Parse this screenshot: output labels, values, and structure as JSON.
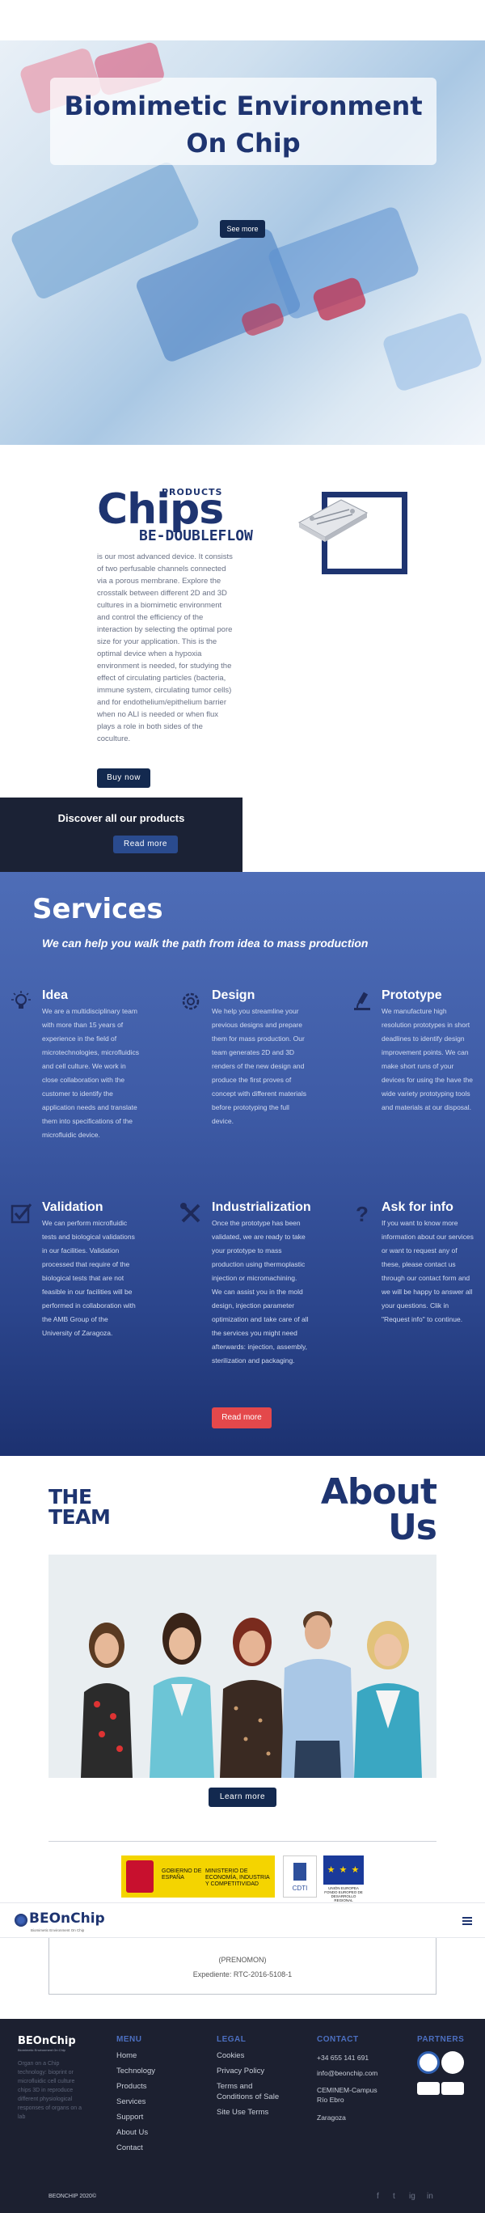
{
  "hero": {
    "title_line1": "Biomimetic  Environment",
    "title_line2": "On Chip",
    "cta": "See more"
  },
  "products": {
    "label": "PRODUCTS",
    "title": "Chips",
    "subtitle": "BE-DOUBLEFLOW",
    "description": "is our most advanced device. It consists of two perfusable channels connected via a porous membrane. Explore the crosstalk between different 2D and 3D cultures in a biomimetic environment and control the efficiency of the interaction by selecting the optimal pore size for your application. This is the optimal device when a hypoxia environment is needed, for studying the effect of circulating particles (bacteria, immune system, circulating tumor cells) and for endothelium/epithelium barrier when no ALI is needed or when flux plays a role in both sides of the coculture.",
    "buy_label": "Buy now",
    "discover_title": "Discover all our products",
    "discover_cta": "Read more"
  },
  "services": {
    "title": "Services",
    "subtitle": "We can help you walk the path from idea to mass production",
    "items": [
      {
        "icon": "lightbulb-icon",
        "title": "Idea",
        "text": "We are a multidisciplinary team with more than 15 years of experience in the field of microtechnologies, microfluidics and cell culture. We work in close collaboration with the customer to identify the application needs and translate them into specifications of the microfluidic device."
      },
      {
        "icon": "design-gear-icon",
        "title": "Design",
        "text": "We help you streamline your previous designs and prepare them for mass production. Our team generates 2D and 3D renders of the new design and produce the first proves of concept with different materials before prototyping the full device."
      },
      {
        "icon": "microscope-icon",
        "title": "Prototype",
        "text": "We manufacture high resolution prototypes in short deadlines to identify design improvement points. We can make short runs of your devices for using the have the wide variety prototyping tools and materials at our disposal."
      },
      {
        "icon": "checkbox-icon",
        "title": "Validation",
        "text": "We can perform microfluidic tests and biological validations in our facilities. Validation processed that require of the biological tests that are not feasible in our facilities will be performed in collaboration with the AMB Group of the University of Zaragoza."
      },
      {
        "icon": "tools-icon",
        "title": "Industrialization",
        "text": "Once the prototype has been validated, we are ready to take your prototype to mass production using thermoplastic injection or micromachining. We can assist you in the mold design, injection parameter optimization and take care of all the services you might need afterwards: injection, assembly, sterilization and packaging."
      },
      {
        "icon": "question-icon",
        "title": "Ask for info",
        "text": "If you want to know more information about our services or want to request any of these, please contact us through our contact form and we will be happy to answer all your questions. Clik in \"Request info\" to continue."
      }
    ],
    "cta": "Read more"
  },
  "team": {
    "the": "THE",
    "team": "TEAM",
    "about_line1": "About",
    "about_line2": "Us",
    "cta": "Learn more"
  },
  "sponsors": {
    "gob_left": "GOBIERNO DE ESPAÑA",
    "gob_right": "MINISTERIO DE ECONOMÍA, INDUSTRIA Y COMPETITIVIDAD",
    "cdti": "CDTI",
    "eu_stars": "★ ★ ★",
    "eu_text": "UNIÓN EUROPEA FONDO EUROPEO DE DESARROLLO REGIONAL"
  },
  "nav": {
    "logo": "BEOnChip",
    "logo_sub": "Biomimetic Environment On Chip"
  },
  "project_box": {
    "line1": "(PRENOMON)",
    "line2": "Expediente: RTC-2016-5108-1"
  },
  "footer": {
    "logo": "BEOnChip",
    "logo_sub": "Biomimetic Environment On Chip",
    "description": "Organ on a Chip technology: bioprint or microfluidic cell culture chips 3D in reproduce different physiological responses of organs on a lab",
    "menu_title": "MENU",
    "menu": [
      "Home",
      "Technology",
      "Products",
      "Services",
      "Support",
      "About Us",
      "Contact"
    ],
    "legal_title": "LEGAL",
    "legal": [
      "Cookies",
      "Privacy Policy",
      "Terms and",
      "Conditions of Sale",
      "Site Use Terms"
    ],
    "contact_title": "CONTACT",
    "contact": [
      "+34 655 141 691",
      "info@beonchip.com",
      "CEMINEM-Campus",
      "Río Ebro",
      "Zaragoza"
    ],
    "partners_title": "PARTNERS",
    "copyright": "BEONCHIP 2020©",
    "social": [
      "f",
      "t",
      "ig",
      "in"
    ]
  },
  "colors": {
    "brand": "#1e3470",
    "accent": "#e4484b",
    "dark": "#1c2030"
  }
}
